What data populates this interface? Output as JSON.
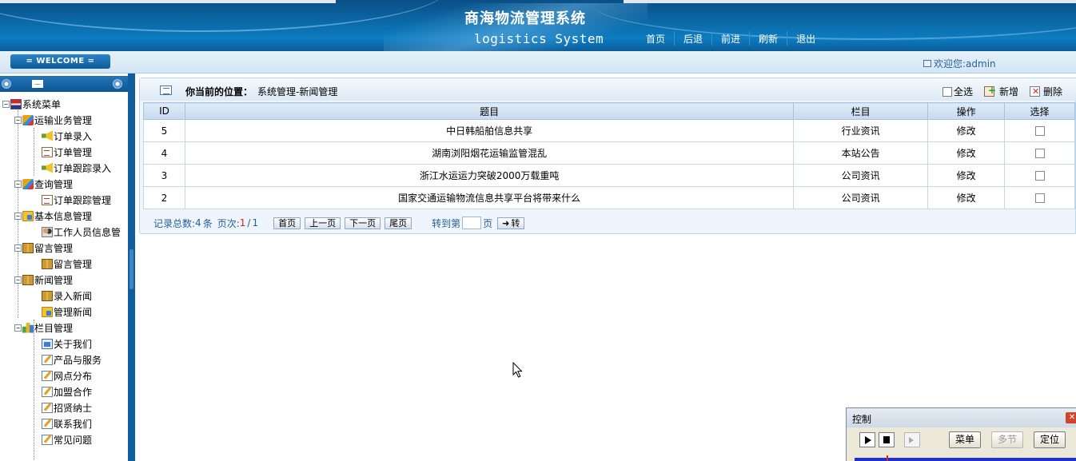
{
  "header": {
    "title": "商海物流管理系统",
    "subtitle": "logistics System",
    "nav": [
      "首页",
      "后退",
      "前进",
      "刷新",
      "退出"
    ]
  },
  "welcome": {
    "badge": "= WELCOME =",
    "user_text": "欢迎您:admin"
  },
  "sidebar": {
    "root": "系统菜单",
    "groups": [
      {
        "label": "运输业务管理",
        "items": [
          "订单录入",
          "订单管理",
          "订单跟踪录入"
        ]
      },
      {
        "label": "查询管理",
        "items": [
          "订单跟踪管理"
        ]
      },
      {
        "label": "基本信息管理",
        "items": [
          "工作人员信息管"
        ]
      },
      {
        "label": "留言管理",
        "items": [
          "留言管理"
        ]
      },
      {
        "label": "新闻管理",
        "items": [
          "录入新闻",
          "管理新闻"
        ]
      },
      {
        "label": "栏目管理",
        "items": [
          "关于我们",
          "产品与服务",
          "网点分布",
          "加盟合作",
          "招贤纳士",
          "联系我们",
          "常见问题"
        ]
      }
    ]
  },
  "main": {
    "location_label": "你当前的位置：",
    "location_value": "系统管理-新闻管理",
    "toolbar": {
      "select_all": "全选",
      "add": "新增",
      "delete": "删除"
    },
    "columns": [
      "ID",
      "题目",
      "栏目",
      "操作",
      "选择"
    ],
    "rows": [
      {
        "id": "5",
        "title": "中日韩船舶信息共享",
        "column": "行业资讯",
        "action": "修改"
      },
      {
        "id": "4",
        "title": "湖南浏阳烟花运输监管混乱",
        "column": "本站公告",
        "action": "修改"
      },
      {
        "id": "3",
        "title": "浙江水运运力突破2000万载重吨",
        "column": "公司资讯",
        "action": "修改"
      },
      {
        "id": "2",
        "title": "国家交通运输物流信息共享平台将带来什么",
        "column": "公司资讯",
        "action": "修改"
      }
    ],
    "pager": {
      "total_label": "记录总数:",
      "total_value": "4",
      "total_unit": "条",
      "page_label": "页次:",
      "page_current": "1",
      "page_sep": "/",
      "page_total": "1",
      "first": "首页",
      "prev": "上一页",
      "next": "下一页",
      "last": "尾页",
      "goto_label": "转到第",
      "goto_unit": "页",
      "go": "转"
    }
  },
  "control_window": {
    "title": "控制",
    "buttons": [
      "菜单",
      "多节",
      "定位"
    ]
  },
  "colors": {
    "header_blue": "#0b6aa8",
    "sidebar_rail": "#0f5d9c",
    "panel_border": "#b9d4ec",
    "pager_text": "#25609a",
    "page_current": "#dd2222"
  }
}
